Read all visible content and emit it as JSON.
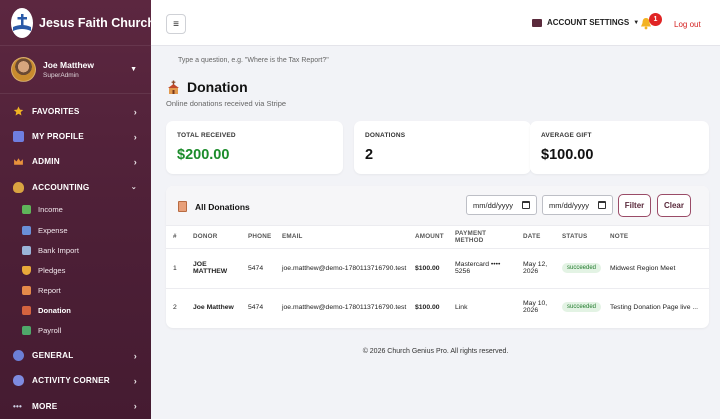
{
  "brand": {
    "name": "Jesus Faith Church"
  },
  "user": {
    "name": "Joe Matthew",
    "role": "SuperAdmin"
  },
  "nav": [
    {
      "label": "FAVORITES",
      "icon": "star-icon",
      "color": "#f0b323"
    },
    {
      "label": "MY PROFILE",
      "icon": "profile-icon",
      "color": "#6f7ee0"
    },
    {
      "label": "ADMIN",
      "icon": "crown-icon",
      "color": "#e8913c"
    },
    {
      "label": "ACCOUNTING",
      "icon": "money-bag-icon",
      "color": "#d9a441"
    }
  ],
  "accounting_items": [
    {
      "label": "Income",
      "icon": "money-icon",
      "color": "#5fb55a"
    },
    {
      "label": "Expense",
      "icon": "card-icon",
      "color": "#6a8fd8"
    },
    {
      "label": "Bank Import",
      "icon": "bank-icon",
      "color": "#9bb4d8"
    },
    {
      "label": "Pledges",
      "icon": "shield-icon",
      "color": "#e9a93a"
    },
    {
      "label": "Report",
      "icon": "report-icon",
      "color": "#e58a4a"
    },
    {
      "label": "Donation",
      "icon": "church-icon",
      "color": "#d4633f"
    },
    {
      "label": "Payroll",
      "icon": "payroll-icon",
      "color": "#4fa86a"
    }
  ],
  "nav_bottom": [
    {
      "label": "GENERAL",
      "icon": "globe-icon",
      "color": "#6c7fd6"
    },
    {
      "label": "ACTIVITY CORNER",
      "icon": "activity-icon",
      "color": "#7e8be0"
    },
    {
      "label": "MORE",
      "icon": "more-icon",
      "color": "#cfd2e6"
    }
  ],
  "topbar": {
    "menu_glyph": "≡",
    "account_settings": "ACCOUNT SETTINGS",
    "notifications": "1",
    "logout": "Log out"
  },
  "search": {
    "placeholder": "Type a question, e.g. \"Where is the Tax Report?\""
  },
  "page": {
    "title": "Donation",
    "subtitle": "Online donations received via Stripe"
  },
  "stats": [
    {
      "label": "TOTAL RECEIVED",
      "value": "$200.00"
    },
    {
      "label": "DONATIONS",
      "value": "2"
    },
    {
      "label": "AVERAGE GIFT",
      "value": "$100.00"
    }
  ],
  "panel": {
    "title": "All Donations",
    "date_from": "mm/dd/yyyy",
    "date_to": "mm/dd/yyyy",
    "filter": "Filter",
    "clear": "Clear"
  },
  "table": {
    "headers": [
      "#",
      "DONOR",
      "PHONE",
      "EMAIL",
      "AMOUNT",
      "PAYMENT METHOD",
      "DATE",
      "STATUS",
      "NOTE"
    ],
    "rows": [
      {
        "num": "1",
        "donor": "JOE MATTHEW",
        "phone": "5474",
        "email": "joe.matthew@demo-1780113716790.test",
        "amount": "$100.00",
        "method": "Mastercard •••• 5256",
        "date": "May 12, 2026",
        "status": "succeeded",
        "note": "Midwest Region Meet"
      },
      {
        "num": "2",
        "donor": "Joe Matthew",
        "phone": "5474",
        "email": "joe.matthew@demo-1780113716790.test",
        "amount": "$100.00",
        "method": "Link",
        "date": "May 10, 2026",
        "status": "succeeded",
        "note": "Testing Donation Page live ..."
      }
    ]
  },
  "footer": "© 2026 Church Genius Pro. All rights reserved."
}
